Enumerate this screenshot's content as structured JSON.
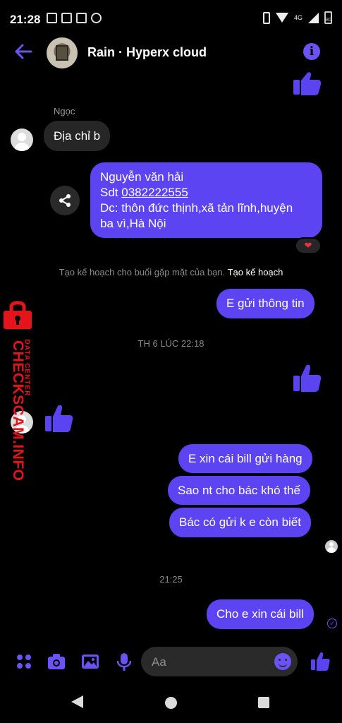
{
  "status_bar": {
    "time": "21:28",
    "network": "4G",
    "battery": "80"
  },
  "header": {
    "title": "Rain · Hyperx cloud",
    "back_icon": "arrow-left-icon",
    "info_icon": "info-icon",
    "info_glyph": "i"
  },
  "messages": {
    "sender_name": "Ngọc",
    "incoming_address_request": "Địa chỉ b",
    "address": {
      "line1": "Nguyễn văn hải",
      "phone_prefix": "Sdt ",
      "phone": "0382222555",
      "line3": "Dc: thôn đức thịnh,xã tản lĩnh,huyện",
      "line4": "ba vì,Hà Nội"
    },
    "reaction": "❤",
    "plan_note": "Tạo kế hoạch cho buổi gặp mặt của bạn.",
    "plan_link": "Tạo kế hoạch",
    "sent_info": "E gửi thông tin",
    "timestamp_1": "TH 6 LÚC 22:18",
    "out_1": "E xin cái bill gửi hàng",
    "out_2": "Sao nt cho bác khó thế",
    "out_3": "Bác có gửi k e còn biết",
    "timestamp_2": "21:25",
    "out_4": "Cho e xin cái bill",
    "sent_check": "✓"
  },
  "watermark": {
    "brand": "CHECKSCAM.INFO",
    "sub": "DATA CENTER"
  },
  "composer": {
    "placeholder": "Aa"
  },
  "colors": {
    "accent": "#5c44f2",
    "background": "#000000",
    "incoming_bubble": "#262626",
    "watermark": "#e4141b"
  }
}
